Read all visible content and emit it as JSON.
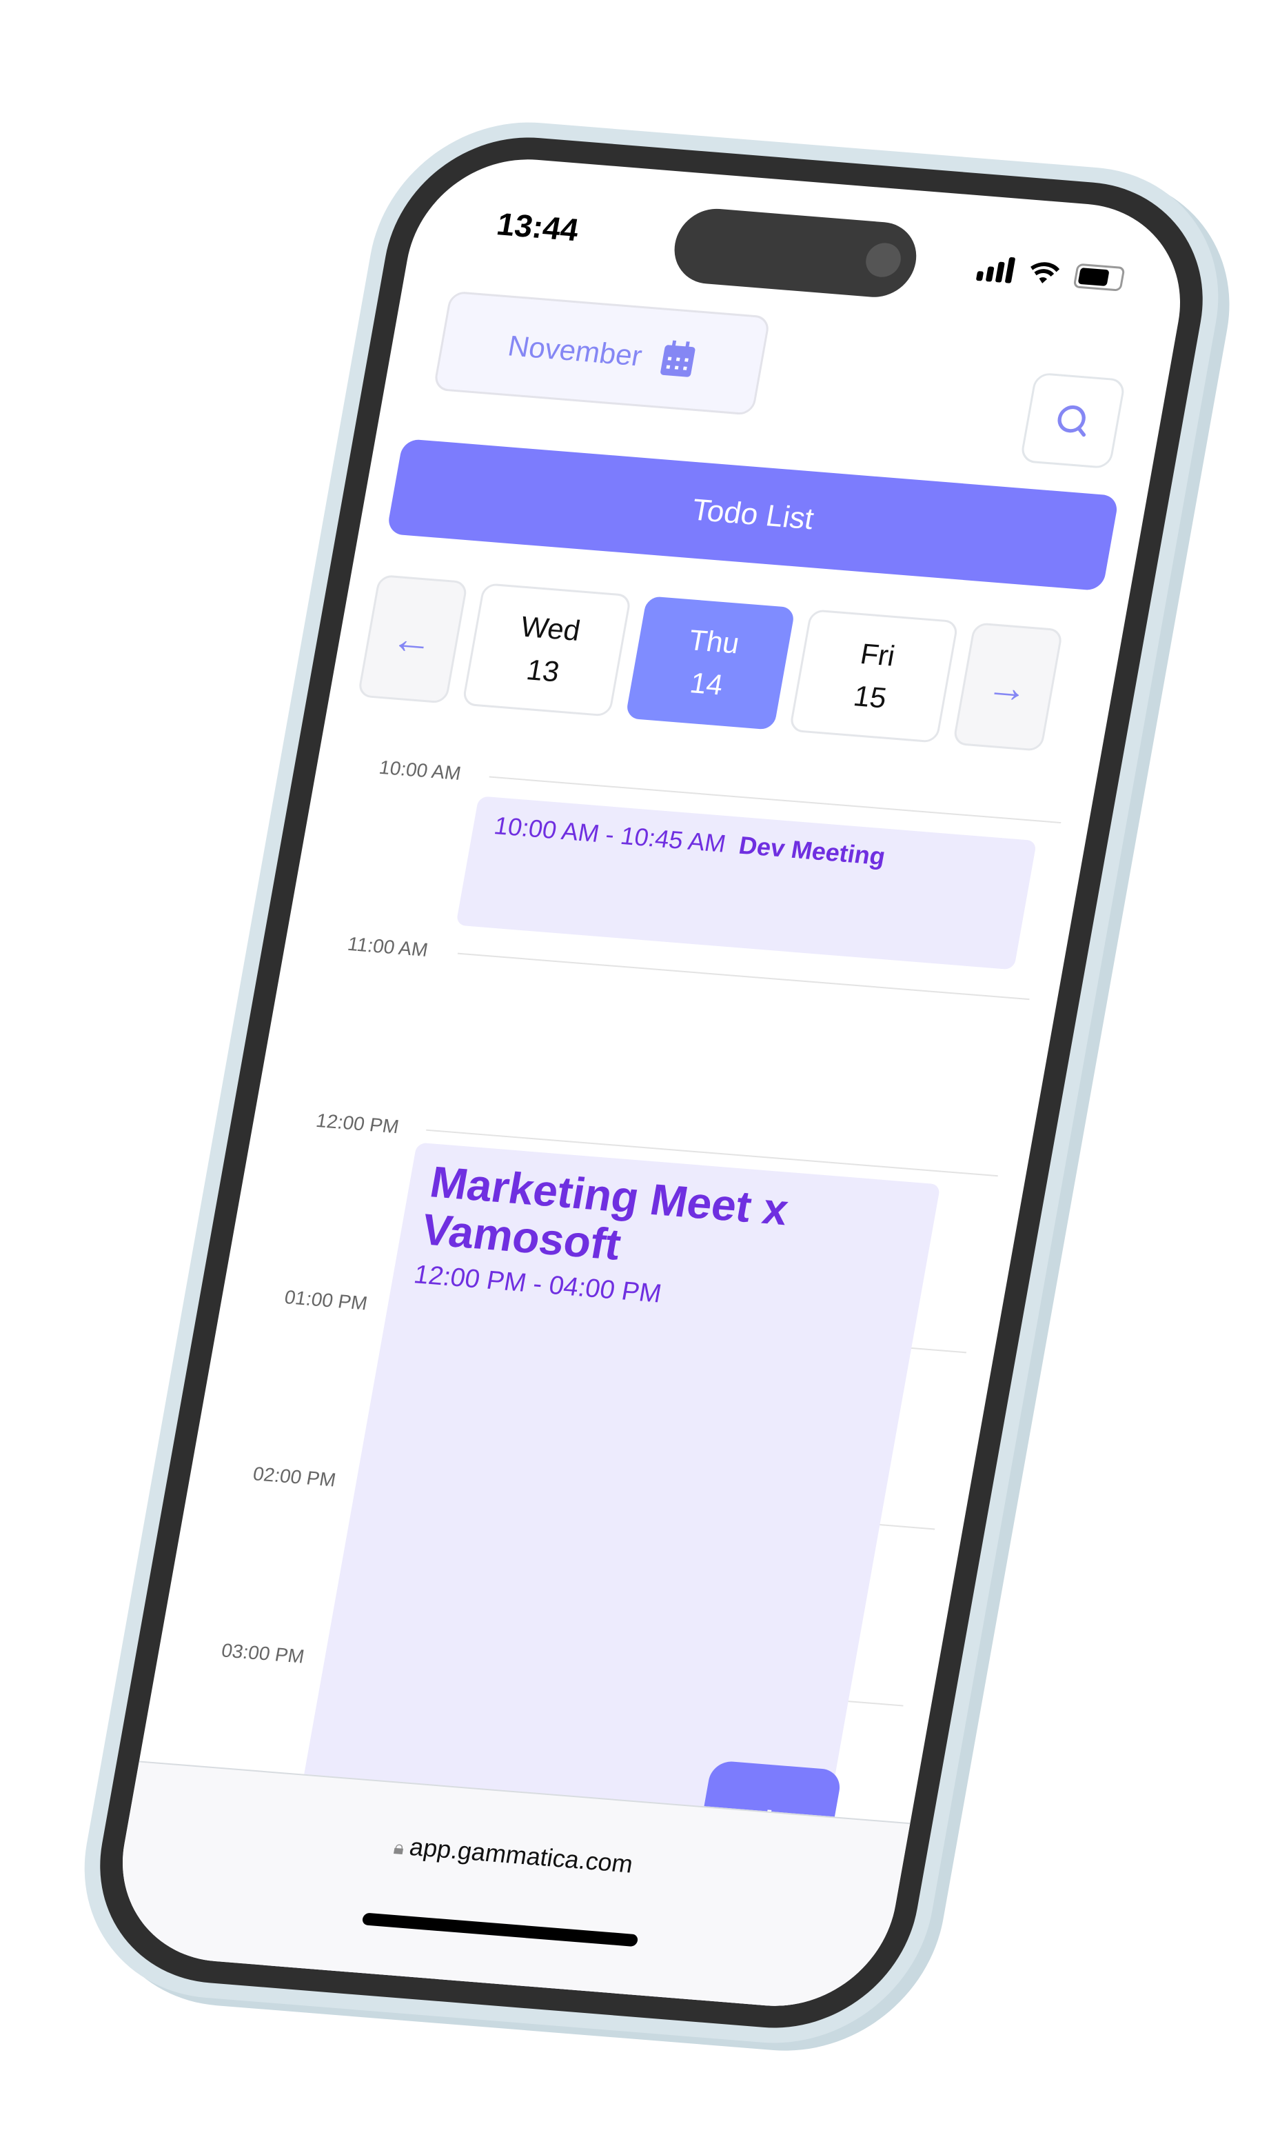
{
  "status_bar": {
    "time": "13:44"
  },
  "header": {
    "month_label": "November",
    "month_icon": "calendar-icon",
    "search_icon": "search-icon"
  },
  "todo_button": {
    "label": "Todo List"
  },
  "days": [
    {
      "weekday": "Wed",
      "date": "13",
      "selected": false
    },
    {
      "weekday": "Thu",
      "date": "14",
      "selected": true
    },
    {
      "weekday": "Fri",
      "date": "15",
      "selected": false
    }
  ],
  "timeline": {
    "hours": [
      "10:00 AM",
      "11:00 AM",
      "12:00 PM",
      "01:00 PM",
      "02:00 PM",
      "03:00 PM"
    ],
    "events": [
      {
        "time": "10:00 AM - 10:45 AM",
        "title": "Dev Meeting"
      },
      {
        "time": "12:00 PM - 04:00 PM",
        "title": "Marketing Meet x Vamosoft"
      }
    ]
  },
  "fab": {
    "label": "+"
  },
  "browser": {
    "url": "app.gammatica.com"
  },
  "colors": {
    "accent": "#7c7cfd",
    "selected_day": "#7f8cff",
    "event_bg": "#edebfd",
    "event_text": "#6f2fe0"
  }
}
